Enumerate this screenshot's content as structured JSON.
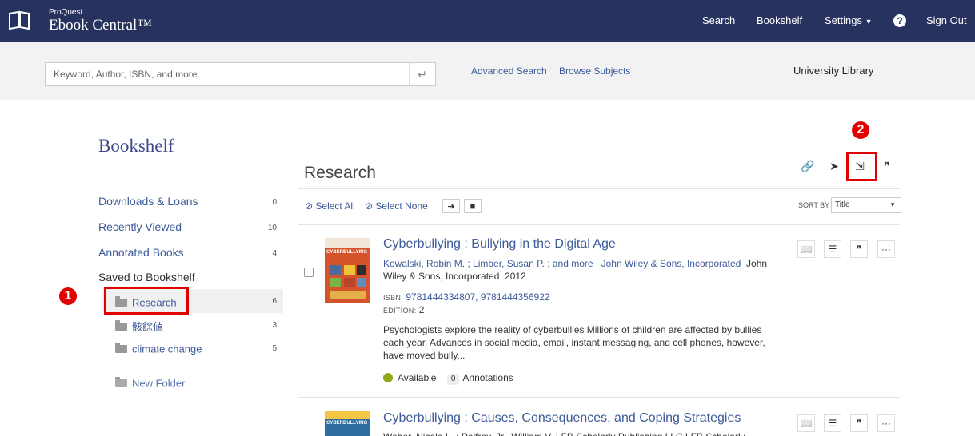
{
  "header": {
    "brand_top": "ProQuest",
    "brand_main": "Ebook Central™",
    "nav": {
      "search": "Search",
      "bookshelf": "Bookshelf",
      "settings": "Settings",
      "help": "?",
      "signout": "Sign Out"
    }
  },
  "search": {
    "placeholder": "Keyword, Author, ISBN, and more",
    "advanced": "Advanced Search",
    "browse": "Browse Subjects",
    "library": "University Library"
  },
  "sidebar": {
    "title": "Bookshelf",
    "items": [
      {
        "label": "Downloads & Loans",
        "count": "0"
      },
      {
        "label": "Recently Viewed",
        "count": "10"
      },
      {
        "label": "Annotated Books",
        "count": "4"
      },
      {
        "label": "Saved to Bookshelf",
        "count": ""
      }
    ],
    "folders": [
      {
        "label": "Research",
        "count": "6"
      },
      {
        "label": "骸餘値",
        "count": "3"
      },
      {
        "label": "climate change",
        "count": "5"
      }
    ],
    "new_folder": "New Folder"
  },
  "main": {
    "title": "Research",
    "select_all": "Select All",
    "select_none": "Select None",
    "sort_by": "SORT BY",
    "sort_value": "Title",
    "books": [
      {
        "title": "Cyberbullying : Bullying in the Digital Age",
        "authors": "Kowalski, Robin M. ; Limber, Susan P. ; and more",
        "publisher_link": "John Wiley & Sons, Incorporated",
        "publisher_tail_1": "John",
        "publisher_tail_2": "Wiley & Sons, Incorporated",
        "year": "2012",
        "isbn_label": "ISBN:",
        "isbn": "9781444334807, 9781444356922",
        "edition_label": "EDITION:",
        "edition": "2",
        "desc_1": "Psychologists explore the reality of cyberbullies Millions of children are affected by bullies",
        "desc_2": "each year. Advances in social media, email, instant messaging, and cell phones, however,",
        "desc_3": "have moved bully...",
        "available": "Available",
        "annotations_count": "0",
        "annotations_label": "Annotations",
        "cover_text": "CYBERBULLYING"
      },
      {
        "title": "Cyberbullying : Causes, Consequences, and Coping Strategies",
        "authors_partial": "Weber, Nicole L. ; Pelfrey, Jr., William V.   LFB Scholarly Publishing LLC  LFB Scholarly",
        "cover_text": "CYBERBULLYING"
      }
    ]
  },
  "annotations": {
    "step1": "1",
    "step2": "2"
  },
  "colors": {
    "header": "#27325e",
    "link": "#3d5a99",
    "highlight": "#e00000"
  }
}
